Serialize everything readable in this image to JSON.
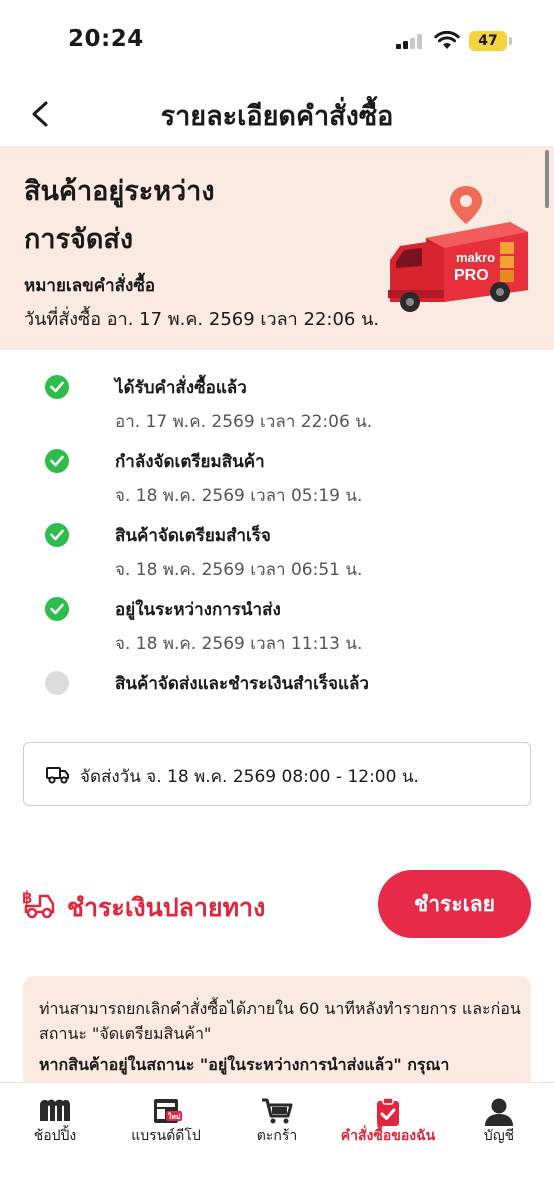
{
  "status_bar": {
    "time": "20:24",
    "battery": "47"
  },
  "header": {
    "title": "รายละเอียดคำสั่งซื้อ"
  },
  "banner": {
    "status_line1": "สินค้าอยู่ระหว่าง",
    "status_line2": "การจัดส่ง",
    "order_number_label": "หมายเลขคำสั่งซื้อ",
    "order_date": "วันที่สั่งซื้อ อา. 17 พ.ค. 2569 เวลา 22:06 น.",
    "truck_brand_top": "makro",
    "truck_brand_bottom": "PRO"
  },
  "timeline": [
    {
      "title": "ได้รับคำสั่งซื้อแล้ว",
      "time": "อา. 17 พ.ค. 2569 เวลา 22:06 น.",
      "done": true
    },
    {
      "title": "กำลังจัดเตรียมสินค้า",
      "time": "จ. 18 พ.ค. 2569 เวลา 05:19 น.",
      "done": true
    },
    {
      "title": "สินค้าจัดเตรียมสำเร็จ",
      "time": "จ. 18 พ.ค. 2569 เวลา 06:51 น.",
      "done": true
    },
    {
      "title": "อยู่ในระหว่างการนำส่ง",
      "time": "จ. 18 พ.ค. 2569 เวลา 11:13 น.",
      "done": true
    },
    {
      "title": "สินค้าจัดส่งและชำระเงินสำเร็จแล้ว",
      "time": "",
      "done": false
    }
  ],
  "delivery": {
    "text": "จัดส่งวัน จ. 18 พ.ค. 2569 08:00 - 12:00 น."
  },
  "payment": {
    "method": "ชำระเงินปลายทาง",
    "pay_button": "ชำระเลย"
  },
  "notice": {
    "line1": "ท่านสามารถยกเลิกคำสั่งซื้อได้ภายใน 60 นาทีหลังทำรายการ และก่อนสถานะ \"จัดเตรียมสินค้า\"",
    "line2": "หากสินค้าอยู่ในสถานะ \"อยู่ในระหว่างการนำส่งแล้ว\" กรุณา"
  },
  "nav": {
    "items": [
      {
        "label": "ช้อปปิ้ง",
        "icon": "makro-m-icon"
      },
      {
        "label": "แบรนด์ดีโป",
        "icon": "store-icon",
        "badge": "ใหม่"
      },
      {
        "label": "ตะกร้า",
        "icon": "cart-icon"
      },
      {
        "label": "คำสั่งซื้อของฉัน",
        "icon": "order-check-icon"
      },
      {
        "label": "บัญชี",
        "icon": "person-icon"
      }
    ],
    "active_index": 3
  },
  "colors": {
    "accent": "#e2263d",
    "success": "#2ebd4c",
    "banner_bg": "#fbeae2"
  }
}
